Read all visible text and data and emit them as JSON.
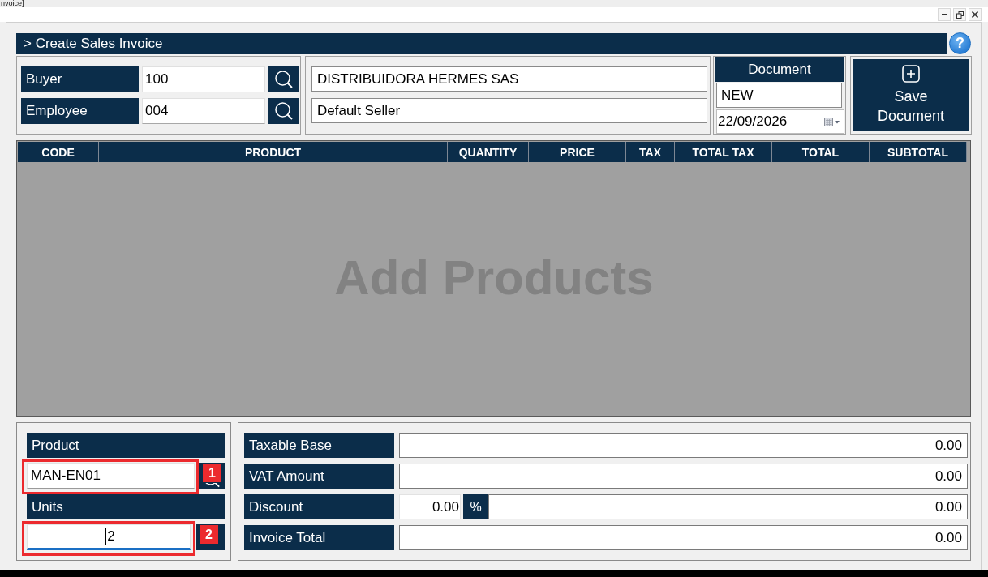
{
  "window": {
    "title": "nvoice]",
    "controls": [
      {
        "kind": "minimize"
      },
      {
        "kind": "restore"
      },
      {
        "kind": "close"
      }
    ]
  },
  "header": {
    "title": "> Create Sales Invoice",
    "help": "?"
  },
  "parties": [
    {
      "label": "Buyer",
      "value": "100",
      "name": "DISTRIBUIDORA HERMES SAS"
    },
    {
      "label": "Employee",
      "value": "004",
      "name": "Default Seller"
    }
  ],
  "document": {
    "title": "Document",
    "number": "NEW",
    "date": "22/09/2026"
  },
  "save_button": {
    "label": "Save Document"
  },
  "table": {
    "columns": [
      "CODE",
      "PRODUCT",
      "QUANTITY",
      "PRICE",
      "TAX",
      "TOTAL TAX",
      "TOTAL",
      "SUBTOTAL"
    ],
    "empty_text": "Add Products"
  },
  "entry": {
    "product": {
      "label": "Product",
      "value": "MAN-EN01",
      "callout": "1"
    },
    "units": {
      "label": "Units",
      "value": "2",
      "focused": true,
      "callout": "2"
    }
  },
  "totals": [
    {
      "kind": "amount",
      "label": "Taxable Base",
      "value": "0.00"
    },
    {
      "kind": "amount",
      "label": "VAT Amount",
      "value": "0.00"
    },
    {
      "kind": "discount",
      "label": "Discount",
      "percent": "0.00",
      "unit": "%",
      "value": "0.00"
    },
    {
      "kind": "amount",
      "label": "Invoice Total",
      "value": "0.00"
    }
  ]
}
